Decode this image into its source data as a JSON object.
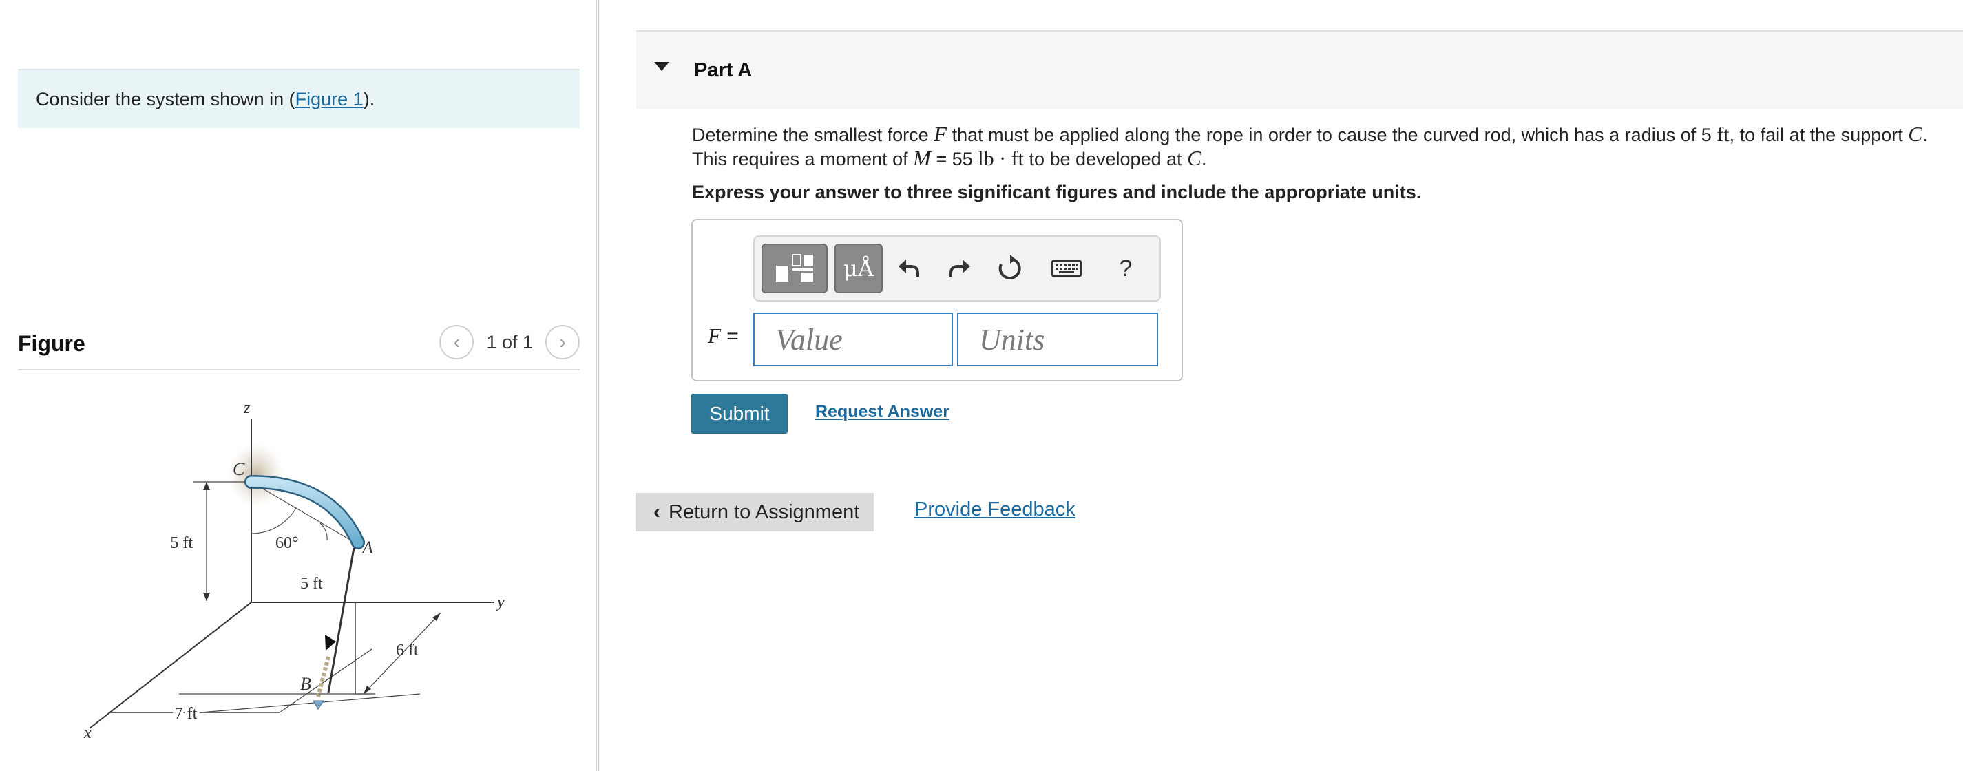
{
  "left": {
    "context_prefix": "Consider the system shown in (",
    "context_link": "Figure 1",
    "context_suffix": ").",
    "figure_title": "Figure",
    "pager": "1 of 1",
    "prev_glyph": "‹",
    "next_glyph": "›",
    "figure_labels": {
      "z": "z",
      "y": "y",
      "x": "x",
      "C": "C",
      "A": "A",
      "B": "B",
      "height": "5 ft",
      "angle": "60°",
      "radius": "5 ft",
      "depth": "6 ft",
      "width": "7 ft"
    }
  },
  "right": {
    "part_title": "Part A",
    "question": {
      "t1": "Determine the smallest force ",
      "F": "F",
      "t2": " that must be applied along the rope in order to cause the curved rod, which has a radius of 5 ",
      "ft1": "ft",
      "t3": ", to fail at the support ",
      "C": "C",
      "t4": ". This requires a moment of ",
      "M": "M",
      "t5": " = 55 ",
      "unit": "lb · ft",
      "t6": " to be developed at ",
      "C2": "C",
      "t7": "."
    },
    "instruction": "Express your answer to three significant figures and include the appropriate units.",
    "toolbar": {
      "mu_label": "μÅ",
      "help_label": "?"
    },
    "answer": {
      "var": "F",
      "equals": " =",
      "value_placeholder": "Value",
      "units_placeholder": "Units"
    },
    "submit_label": "Submit",
    "request_answer_label": "Request Answer",
    "return_label": "Return to Assignment",
    "return_glyph": "‹",
    "feedback_label": "Provide Feedback"
  }
}
